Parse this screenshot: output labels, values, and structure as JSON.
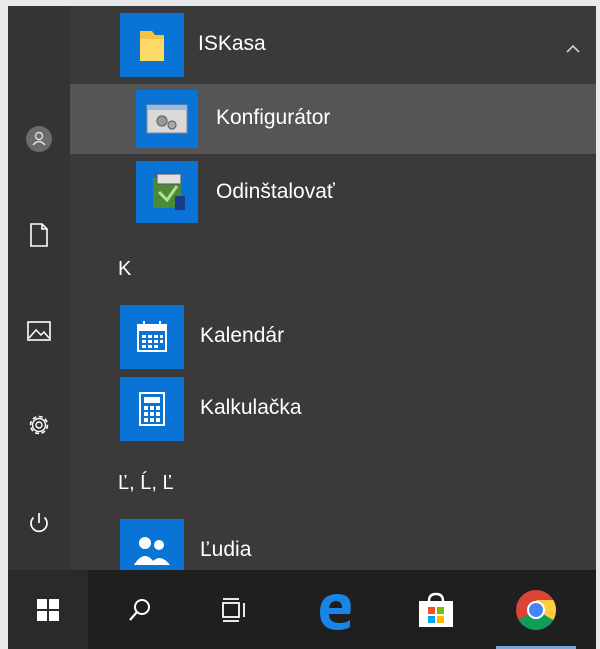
{
  "rail": {
    "items": [
      {
        "icon": "user-icon"
      },
      {
        "icon": "document-icon"
      },
      {
        "icon": "pictures-icon"
      },
      {
        "icon": "settings-icon"
      },
      {
        "icon": "power-icon"
      }
    ]
  },
  "apps": {
    "folder_iskasa": {
      "label": "ISKasa",
      "icon": "folder-icon"
    },
    "konfigurator": {
      "label": "Konfigurátor",
      "icon": "configurator-icon"
    },
    "odinstalovat": {
      "label": "Odinštalovať",
      "icon": "uninstall-icon"
    },
    "group_k": "K",
    "kalendar": {
      "label": "Kalendár",
      "icon": "calendar-icon"
    },
    "kalkulacka": {
      "label": "Kalkulačka",
      "icon": "calculator-icon"
    },
    "group_l": "Ľ, Ĺ, Ľ",
    "ludia": {
      "label": "Ľudia",
      "icon": "people-icon"
    }
  },
  "taskbar": {
    "items": [
      "windows-start-icon",
      "search-icon",
      "task-view-icon",
      "edge-icon",
      "store-icon",
      "chrome-icon"
    ]
  },
  "colors": {
    "tile_blue": "#0a74d6",
    "menu_bg": "#3a3a3a",
    "rail_bg": "#343434",
    "taskbar_bg": "#1f1f1f",
    "highlight": "#555555"
  }
}
